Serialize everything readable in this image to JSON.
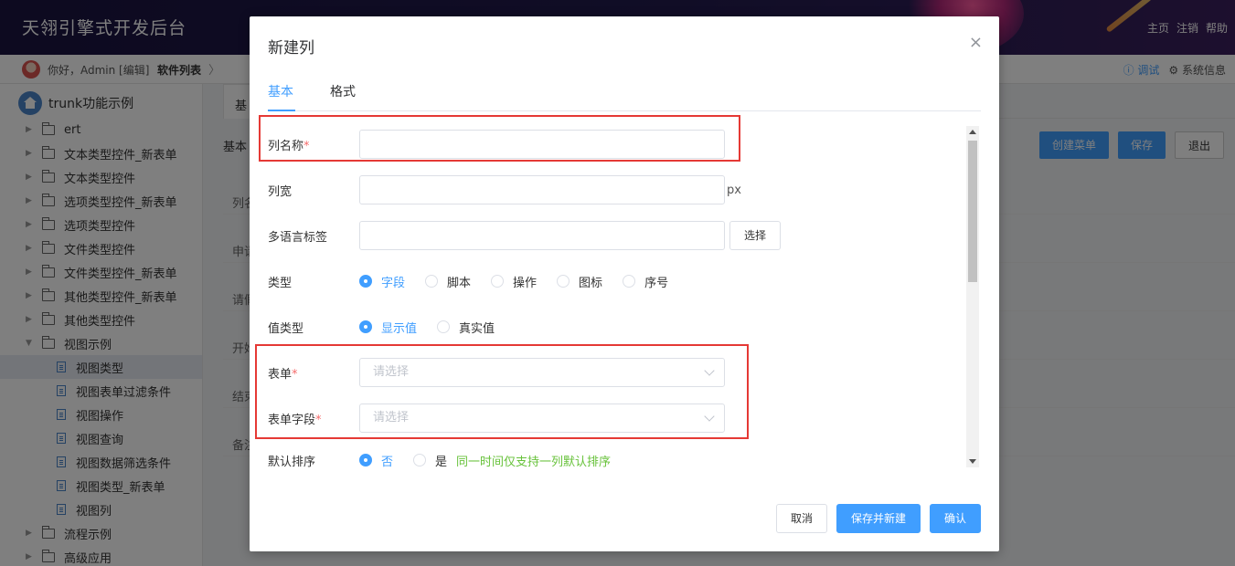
{
  "header": {
    "title": "天翎引擎式开发后台",
    "links": [
      "主页",
      "注销",
      "帮助"
    ]
  },
  "breadcrumb": {
    "greeting": "你好，Admin [编辑]",
    "page": "软件列表",
    "chevron": "〉",
    "debug": "ⓘ 调试",
    "sysinfo": "⚙ 系统信息"
  },
  "sidebar": {
    "root": "trunk功能示例",
    "folders": [
      {
        "label": "ert",
        "open": false
      },
      {
        "label": "文本类型控件_新表单",
        "open": false
      },
      {
        "label": "文本类型控件",
        "open": false
      },
      {
        "label": "选项类型控件_新表单",
        "open": false
      },
      {
        "label": "选项类型控件",
        "open": false
      },
      {
        "label": "文件类型控件",
        "open": false
      },
      {
        "label": "文件类型控件_新表单",
        "open": false
      },
      {
        "label": "其他类型控件_新表单",
        "open": false
      },
      {
        "label": "其他类型控件",
        "open": false
      },
      {
        "label": "视图示例",
        "open": true
      }
    ],
    "children": [
      "视图类型",
      "视图表单过滤条件",
      "视图操作",
      "视图查询",
      "视图数据筛选条件",
      "视图类型_新表单",
      "视图列"
    ],
    "after": [
      "流程示例",
      "高级应用"
    ]
  },
  "background": {
    "tab": "基",
    "section": "基本",
    "buttons": {
      "create_menu": "创建菜单",
      "save": "保存",
      "exit": "退出"
    },
    "rows": [
      "列名",
      "申请",
      "请假",
      "开始",
      "结束",
      "备注"
    ]
  },
  "modal": {
    "title": "新建列",
    "close": "×",
    "tabs": [
      "基本",
      "格式"
    ],
    "fields": {
      "name_label": "列名称",
      "width_label": "列宽",
      "width_suffix": "px",
      "i18n_label": "多语言标签",
      "select_btn": "选择",
      "type_label": "类型",
      "type_options": [
        "字段",
        "脚本",
        "操作",
        "图标",
        "序号"
      ],
      "value_type_label": "值类型",
      "value_type_options": [
        "显示值",
        "真实值"
      ],
      "form_label": "表单",
      "form_placeholder": "请选择",
      "form_field_label": "表单字段",
      "form_field_placeholder": "请选择",
      "sort_label": "默认排序",
      "sort_options": [
        "否",
        "是"
      ],
      "sort_hint": "同一时间仅支持一列默认排序"
    },
    "required_mark": "*",
    "footer": {
      "cancel": "取消",
      "save_new": "保存并新建",
      "confirm": "确认"
    }
  }
}
